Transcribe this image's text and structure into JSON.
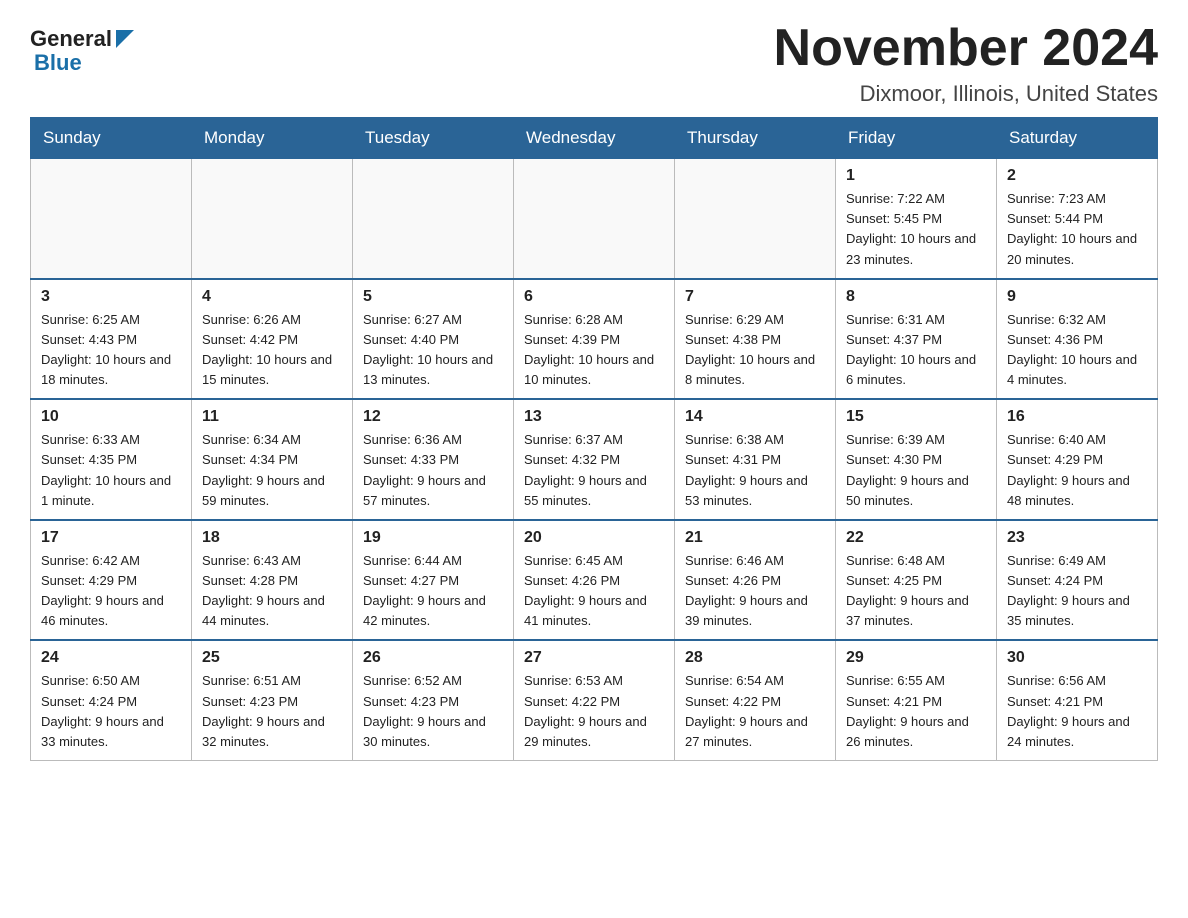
{
  "header": {
    "logo_general": "General",
    "logo_blue": "Blue",
    "month_title": "November 2024",
    "location": "Dixmoor, Illinois, United States"
  },
  "weekdays": [
    "Sunday",
    "Monday",
    "Tuesday",
    "Wednesday",
    "Thursday",
    "Friday",
    "Saturday"
  ],
  "weeks": [
    [
      {
        "day": "",
        "sunrise": "",
        "sunset": "",
        "daylight": ""
      },
      {
        "day": "",
        "sunrise": "",
        "sunset": "",
        "daylight": ""
      },
      {
        "day": "",
        "sunrise": "",
        "sunset": "",
        "daylight": ""
      },
      {
        "day": "",
        "sunrise": "",
        "sunset": "",
        "daylight": ""
      },
      {
        "day": "",
        "sunrise": "",
        "sunset": "",
        "daylight": ""
      },
      {
        "day": "1",
        "sunrise": "Sunrise: 7:22 AM",
        "sunset": "Sunset: 5:45 PM",
        "daylight": "Daylight: 10 hours and 23 minutes."
      },
      {
        "day": "2",
        "sunrise": "Sunrise: 7:23 AM",
        "sunset": "Sunset: 5:44 PM",
        "daylight": "Daylight: 10 hours and 20 minutes."
      }
    ],
    [
      {
        "day": "3",
        "sunrise": "Sunrise: 6:25 AM",
        "sunset": "Sunset: 4:43 PM",
        "daylight": "Daylight: 10 hours and 18 minutes."
      },
      {
        "day": "4",
        "sunrise": "Sunrise: 6:26 AM",
        "sunset": "Sunset: 4:42 PM",
        "daylight": "Daylight: 10 hours and 15 minutes."
      },
      {
        "day": "5",
        "sunrise": "Sunrise: 6:27 AM",
        "sunset": "Sunset: 4:40 PM",
        "daylight": "Daylight: 10 hours and 13 minutes."
      },
      {
        "day": "6",
        "sunrise": "Sunrise: 6:28 AM",
        "sunset": "Sunset: 4:39 PM",
        "daylight": "Daylight: 10 hours and 10 minutes."
      },
      {
        "day": "7",
        "sunrise": "Sunrise: 6:29 AM",
        "sunset": "Sunset: 4:38 PM",
        "daylight": "Daylight: 10 hours and 8 minutes."
      },
      {
        "day": "8",
        "sunrise": "Sunrise: 6:31 AM",
        "sunset": "Sunset: 4:37 PM",
        "daylight": "Daylight: 10 hours and 6 minutes."
      },
      {
        "day": "9",
        "sunrise": "Sunrise: 6:32 AM",
        "sunset": "Sunset: 4:36 PM",
        "daylight": "Daylight: 10 hours and 4 minutes."
      }
    ],
    [
      {
        "day": "10",
        "sunrise": "Sunrise: 6:33 AM",
        "sunset": "Sunset: 4:35 PM",
        "daylight": "Daylight: 10 hours and 1 minute."
      },
      {
        "day": "11",
        "sunrise": "Sunrise: 6:34 AM",
        "sunset": "Sunset: 4:34 PM",
        "daylight": "Daylight: 9 hours and 59 minutes."
      },
      {
        "day": "12",
        "sunrise": "Sunrise: 6:36 AM",
        "sunset": "Sunset: 4:33 PM",
        "daylight": "Daylight: 9 hours and 57 minutes."
      },
      {
        "day": "13",
        "sunrise": "Sunrise: 6:37 AM",
        "sunset": "Sunset: 4:32 PM",
        "daylight": "Daylight: 9 hours and 55 minutes."
      },
      {
        "day": "14",
        "sunrise": "Sunrise: 6:38 AM",
        "sunset": "Sunset: 4:31 PM",
        "daylight": "Daylight: 9 hours and 53 minutes."
      },
      {
        "day": "15",
        "sunrise": "Sunrise: 6:39 AM",
        "sunset": "Sunset: 4:30 PM",
        "daylight": "Daylight: 9 hours and 50 minutes."
      },
      {
        "day": "16",
        "sunrise": "Sunrise: 6:40 AM",
        "sunset": "Sunset: 4:29 PM",
        "daylight": "Daylight: 9 hours and 48 minutes."
      }
    ],
    [
      {
        "day": "17",
        "sunrise": "Sunrise: 6:42 AM",
        "sunset": "Sunset: 4:29 PM",
        "daylight": "Daylight: 9 hours and 46 minutes."
      },
      {
        "day": "18",
        "sunrise": "Sunrise: 6:43 AM",
        "sunset": "Sunset: 4:28 PM",
        "daylight": "Daylight: 9 hours and 44 minutes."
      },
      {
        "day": "19",
        "sunrise": "Sunrise: 6:44 AM",
        "sunset": "Sunset: 4:27 PM",
        "daylight": "Daylight: 9 hours and 42 minutes."
      },
      {
        "day": "20",
        "sunrise": "Sunrise: 6:45 AM",
        "sunset": "Sunset: 4:26 PM",
        "daylight": "Daylight: 9 hours and 41 minutes."
      },
      {
        "day": "21",
        "sunrise": "Sunrise: 6:46 AM",
        "sunset": "Sunset: 4:26 PM",
        "daylight": "Daylight: 9 hours and 39 minutes."
      },
      {
        "day": "22",
        "sunrise": "Sunrise: 6:48 AM",
        "sunset": "Sunset: 4:25 PM",
        "daylight": "Daylight: 9 hours and 37 minutes."
      },
      {
        "day": "23",
        "sunrise": "Sunrise: 6:49 AM",
        "sunset": "Sunset: 4:24 PM",
        "daylight": "Daylight: 9 hours and 35 minutes."
      }
    ],
    [
      {
        "day": "24",
        "sunrise": "Sunrise: 6:50 AM",
        "sunset": "Sunset: 4:24 PM",
        "daylight": "Daylight: 9 hours and 33 minutes."
      },
      {
        "day": "25",
        "sunrise": "Sunrise: 6:51 AM",
        "sunset": "Sunset: 4:23 PM",
        "daylight": "Daylight: 9 hours and 32 minutes."
      },
      {
        "day": "26",
        "sunrise": "Sunrise: 6:52 AM",
        "sunset": "Sunset: 4:23 PM",
        "daylight": "Daylight: 9 hours and 30 minutes."
      },
      {
        "day": "27",
        "sunrise": "Sunrise: 6:53 AM",
        "sunset": "Sunset: 4:22 PM",
        "daylight": "Daylight: 9 hours and 29 minutes."
      },
      {
        "day": "28",
        "sunrise": "Sunrise: 6:54 AM",
        "sunset": "Sunset: 4:22 PM",
        "daylight": "Daylight: 9 hours and 27 minutes."
      },
      {
        "day": "29",
        "sunrise": "Sunrise: 6:55 AM",
        "sunset": "Sunset: 4:21 PM",
        "daylight": "Daylight: 9 hours and 26 minutes."
      },
      {
        "day": "30",
        "sunrise": "Sunrise: 6:56 AM",
        "sunset": "Sunset: 4:21 PM",
        "daylight": "Daylight: 9 hours and 24 minutes."
      }
    ]
  ]
}
